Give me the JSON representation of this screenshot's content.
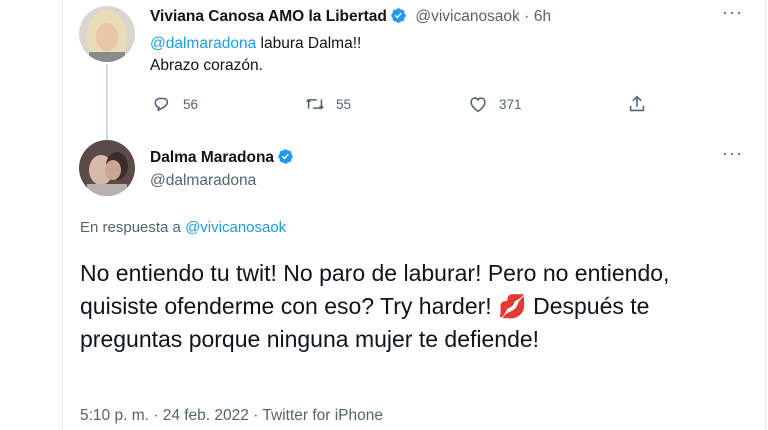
{
  "tweet1": {
    "display_name": "Viviana Canosa AMO la Libertad",
    "handle": "@vivicanosaok",
    "separator": "·",
    "time": "6h",
    "mention": "@dalmaradona",
    "text_line1_rest": " labura Dalma!!",
    "text_line2": "Abrazo corazón.",
    "replies": "56",
    "retweets": "55",
    "likes": "371"
  },
  "tweet2": {
    "display_name": "Dalma Maradona",
    "handle": "@dalmaradona",
    "reply_prefix": "En respuesta a ",
    "reply_to": "@vivicanosaok",
    "text": "No entiendo tu twit! No paro de laburar! Pero no entiendo, quisiste ofenderme con eso? Try harder!",
    "emoji": "💋",
    "text_end": " Después te preguntas porque ninguna mujer te defiende!",
    "timestamp": "5:10 p. m. · 24 feb. 2022 · Twitter for iPhone"
  },
  "colors": {
    "accent": "#1d9bf0",
    "text": "#0f1419",
    "muted": "#536471"
  }
}
